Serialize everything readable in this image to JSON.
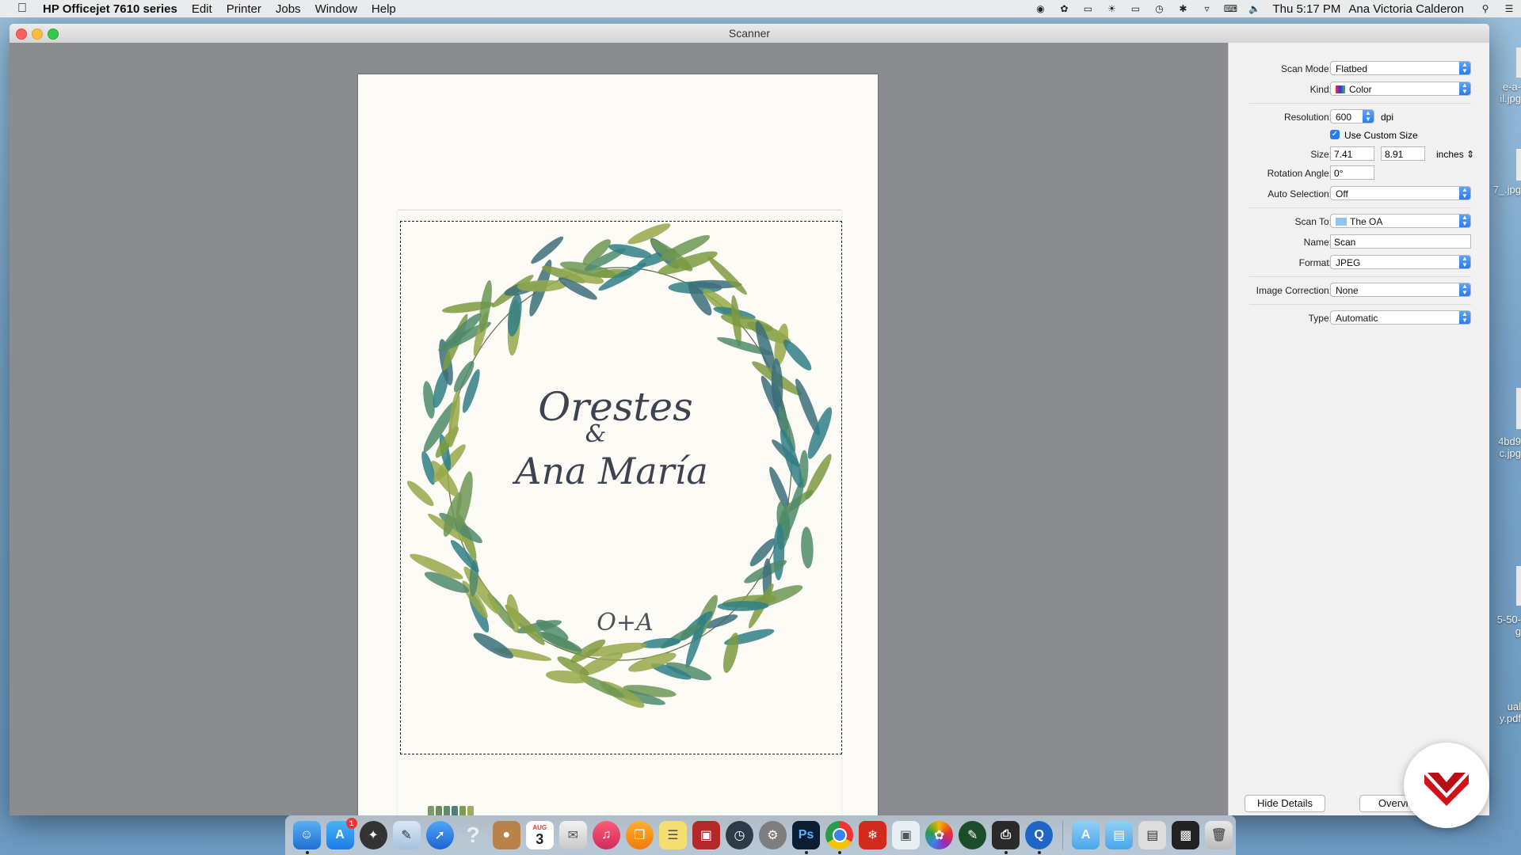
{
  "menubar": {
    "app_name": "HP Officejet 7610 series",
    "menus": [
      "Edit",
      "Printer",
      "Jobs",
      "Window",
      "Help"
    ],
    "clock": "Thu 5:17 PM",
    "user": "Ana Victoria Calderon"
  },
  "desktop": {
    "files": [
      "e-a-\nil.jpg",
      "7_.jpg",
      "4bd9\nc.jpg",
      "5-50-\ng",
      "ual\ny.pdf"
    ]
  },
  "window": {
    "title": "Scanner"
  },
  "artwork": {
    "names_line1": "Orestes",
    "ampersand": "&",
    "names_line2": "Ana María",
    "monogram": "O+A"
  },
  "settings": {
    "scan_mode_label": "Scan Mode:",
    "scan_mode_value": "Flatbed",
    "kind_label": "Kind:",
    "kind_value": "Color",
    "resolution_label": "Resolution:",
    "resolution_value": "600",
    "resolution_unit": "dpi",
    "custom_size_label": "Use Custom Size",
    "custom_size_checked": true,
    "size_label": "Size:",
    "size_width": "7.41",
    "size_height": "8.91",
    "size_unit": "inches",
    "rotation_label": "Rotation Angle:",
    "rotation_value": "0°",
    "auto_selection_label": "Auto Selection:",
    "auto_selection_value": "Off",
    "scan_to_label": "Scan To:",
    "scan_to_value": "The OA",
    "name_label": "Name:",
    "name_value": "Scan",
    "format_label": "Format:",
    "format_value": "JPEG",
    "image_correction_label": "Image Correction:",
    "image_correction_value": "None",
    "type_label": "Type:",
    "type_value": "Automatic"
  },
  "buttons": {
    "hide_details": "Hide Details",
    "overview": "Overview"
  },
  "dock": {
    "calendar_day": "3",
    "calendar_month": "AUG",
    "badge_count": "1"
  },
  "colors": {
    "accent": "#2a7bf0",
    "leaf_teal": "#2f7f86",
    "leaf_green": "#7d9a3f",
    "logo_red": "#d0121b"
  }
}
